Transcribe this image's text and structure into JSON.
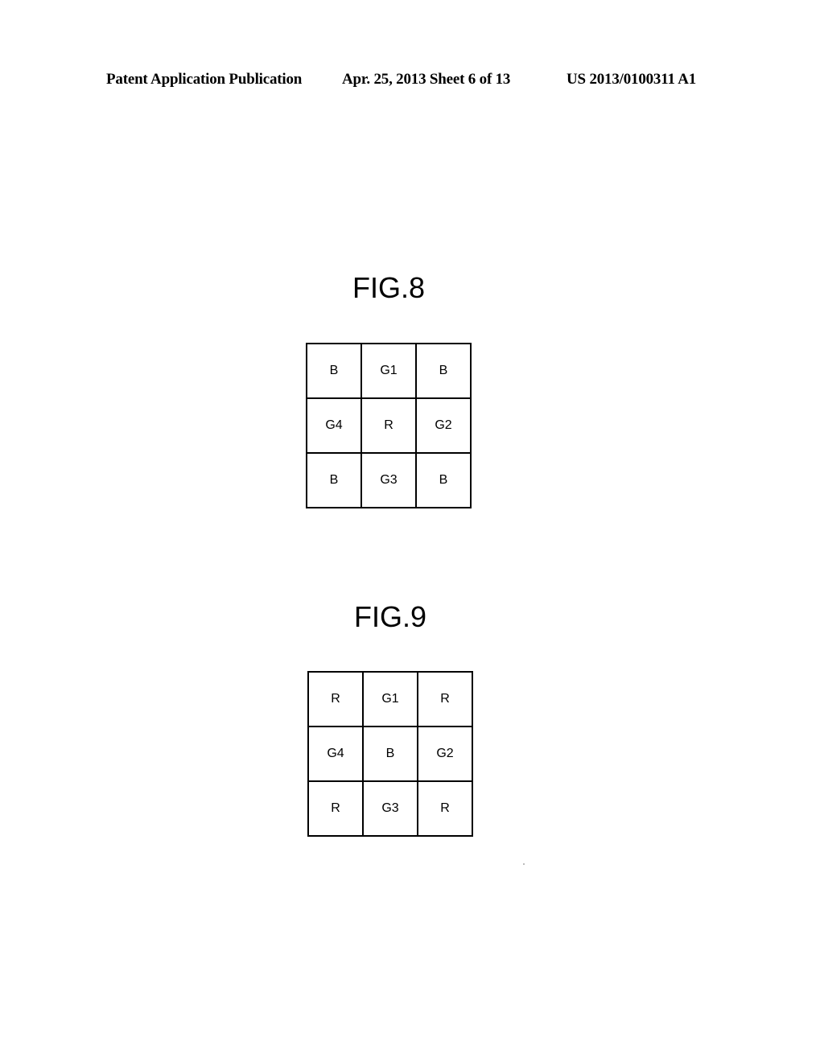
{
  "header": {
    "publication": "Patent Application Publication",
    "date_sheet": "Apr. 25, 2013  Sheet 6 of 13",
    "number": "US 2013/0100311 A1"
  },
  "figures": [
    {
      "title": "FIG.8",
      "cells": [
        [
          "B",
          "G1",
          "B"
        ],
        [
          "G4",
          "R",
          "G2"
        ],
        [
          "B",
          "G3",
          "B"
        ]
      ]
    },
    {
      "title": "FIG.9",
      "cells": [
        [
          "R",
          "G1",
          "R"
        ],
        [
          "G4",
          "B",
          "G2"
        ],
        [
          "R",
          "G3",
          "R"
        ]
      ]
    }
  ]
}
